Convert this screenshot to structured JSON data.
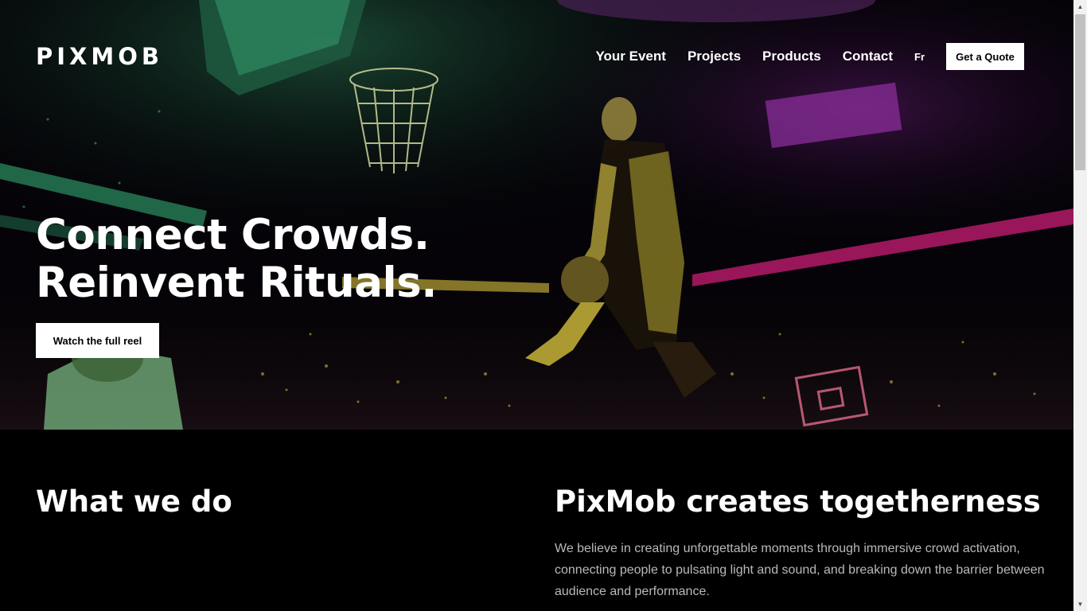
{
  "brand": {
    "logo_text": "PIXMOB"
  },
  "nav": {
    "items": [
      {
        "label": "Your Event"
      },
      {
        "label": "Projects"
      },
      {
        "label": "Products"
      },
      {
        "label": "Contact"
      }
    ],
    "language": "Fr",
    "quote_label": "Get a Quote"
  },
  "hero": {
    "headline_line1": "Connect Crowds.",
    "headline_line2": "Reinvent Rituals.",
    "reel_button_label": "Watch the full reel",
    "colors": {
      "green": "#3fd08a",
      "magenta": "#e0208a",
      "yellow": "#c9b23a",
      "purple": "#a23fcf"
    }
  },
  "section": {
    "left_title": "What we do",
    "right_title": "PixMob creates togetherness",
    "right_body": "We believe in creating unforgettable moments through immersive crowd activation, connecting people to pulsating light and sound, and breaking down the barrier between audience and performance."
  }
}
